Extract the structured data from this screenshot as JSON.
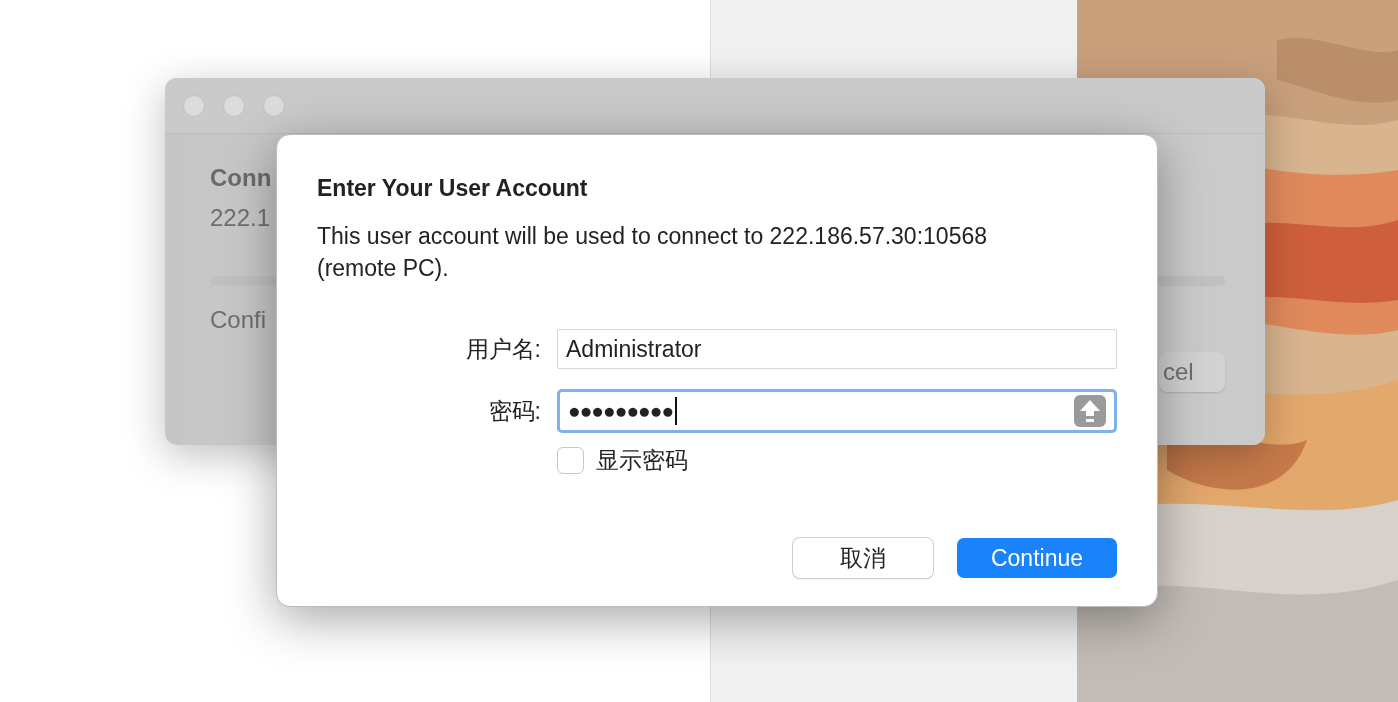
{
  "background_window": {
    "heading": "Conn",
    "address": "222.1",
    "status": "Confi",
    "button": "cel"
  },
  "dialog": {
    "title": "Enter Your User Account",
    "message": "This user account will be used to connect to 222.186.57.30:10568 (remote PC).",
    "fields": [
      {
        "kind": "text",
        "label": "用户名:",
        "value": "Administrator",
        "focused": false
      },
      {
        "kind": "password",
        "label": "密码:",
        "value": "●●●●●●●●●",
        "focused": true,
        "caps_lock": true
      }
    ],
    "show_password": {
      "label": "显示密码",
      "checked": false
    },
    "buttons": [
      {
        "label": "取消",
        "kind": "default"
      },
      {
        "label": "Continue",
        "kind": "primary"
      }
    ]
  }
}
